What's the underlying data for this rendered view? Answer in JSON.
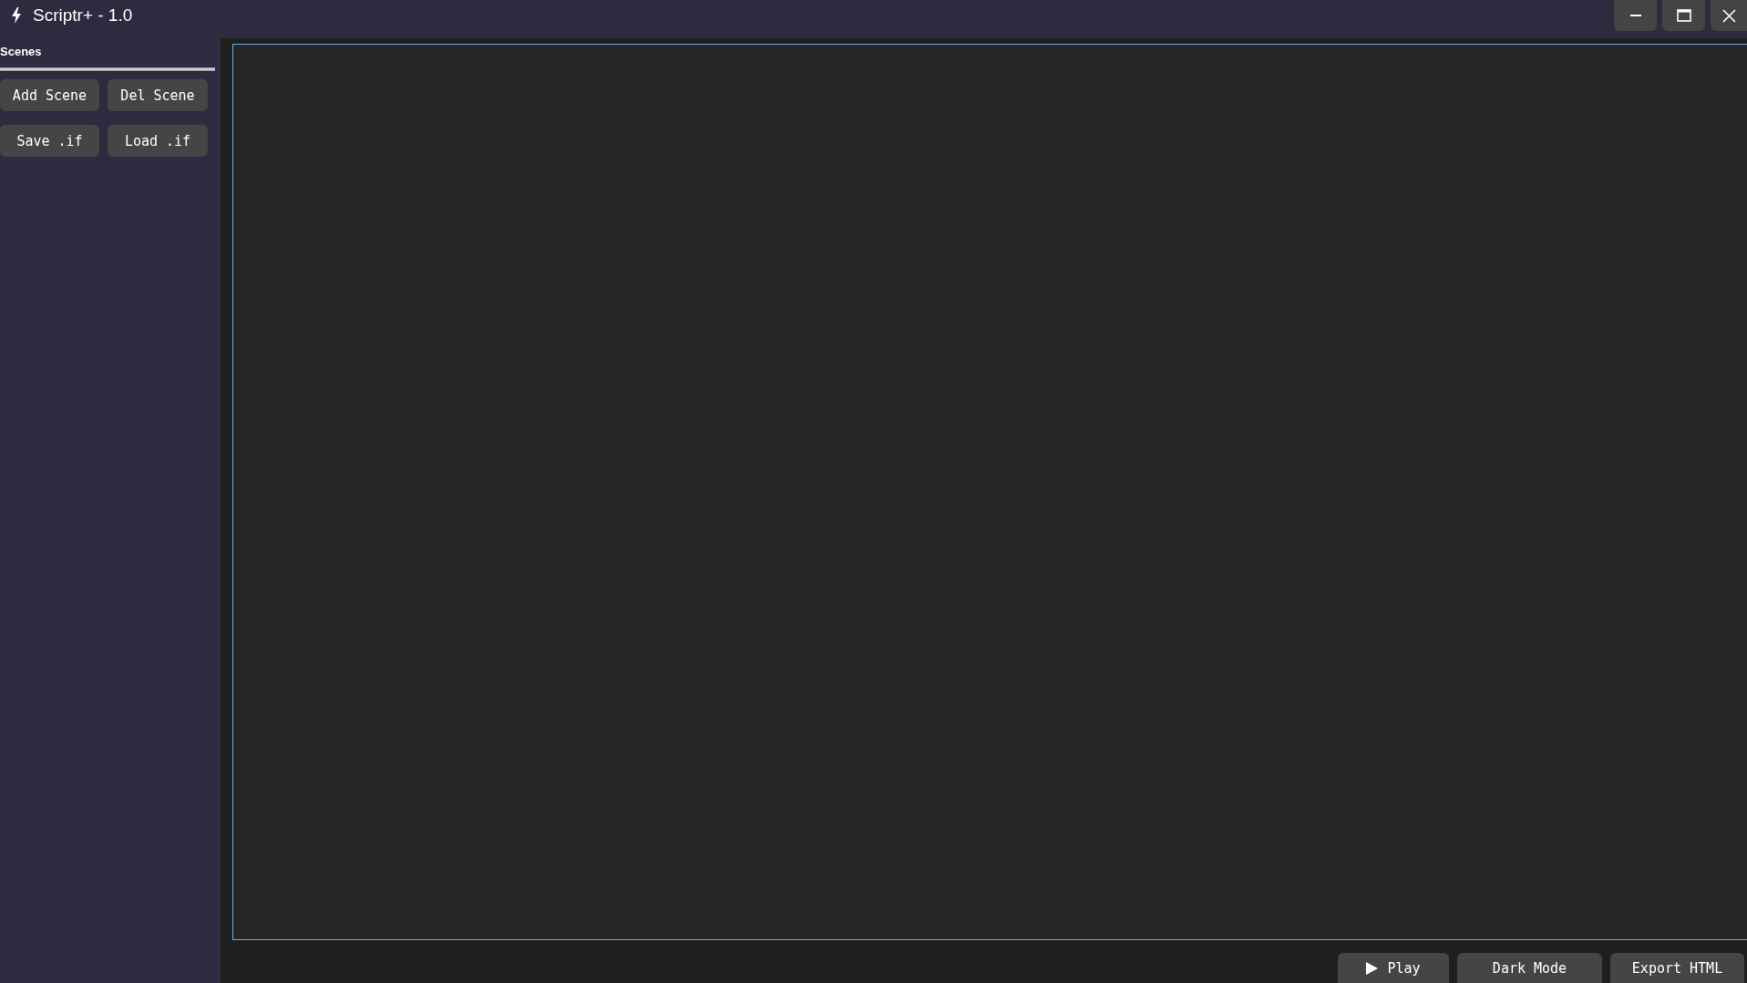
{
  "window": {
    "title": "Scriptr+ - 1.0"
  },
  "sidebar": {
    "heading": "Scenes",
    "buttons": [
      "Add Scene",
      "Del Scene",
      "Save .if",
      "Load .if"
    ]
  },
  "toolbar": {
    "buttons": [
      {
        "kind": "icon",
        "label": "Play"
      },
      {
        "kind": "text",
        "label": "Dark Mode"
      },
      {
        "kind": "text",
        "label": "Export HTML"
      }
    ]
  }
}
